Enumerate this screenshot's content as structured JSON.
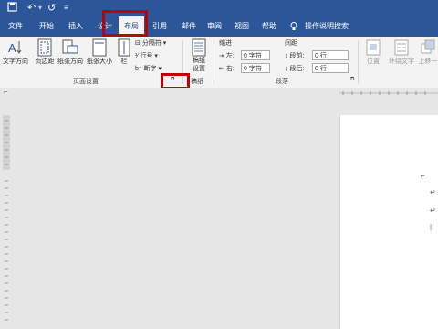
{
  "quick_access": {
    "save_icon": "save-icon",
    "undo_icon": "undo-icon",
    "redo_icon": "redo-icon",
    "customize_icon": "customize-icon"
  },
  "tabs": [
    {
      "label": "文件"
    },
    {
      "label": "开始"
    },
    {
      "label": "插入"
    },
    {
      "label": "设计"
    },
    {
      "label": "布局",
      "active": true
    },
    {
      "label": "引用"
    },
    {
      "label": "邮件"
    },
    {
      "label": "审阅"
    },
    {
      "label": "视图"
    },
    {
      "label": "帮助"
    }
  ],
  "search": {
    "label": "操作说明搜索",
    "icon": "lightbulb-icon"
  },
  "page_setup": {
    "text_direction": "文字方向",
    "margins": "页边距",
    "orientation": "纸张方向",
    "size": "纸张大小",
    "columns": "栏",
    "breaks": "分隔符",
    "line_numbers": "行号",
    "hyphenation": "断字",
    "group_label": "页面设置"
  },
  "manuscript": {
    "button": "稿纸设置",
    "group_label": "稿纸"
  },
  "paragraph": {
    "indent_label": "缩进",
    "spacing_label": "间距",
    "left_label": "左:",
    "right_label": "右:",
    "before_label": "段前:",
    "after_label": "段后:",
    "left_value": "0 字符",
    "right_value": "0 字符",
    "before_value": "0 行",
    "after_value": "0 行",
    "group_label": "段落"
  },
  "arrange": {
    "position": "位置",
    "wrap_text": "环绕文字",
    "bring_forward": "上移一"
  },
  "colors": {
    "brand": "#2b579a",
    "highlight": "#c00000"
  }
}
